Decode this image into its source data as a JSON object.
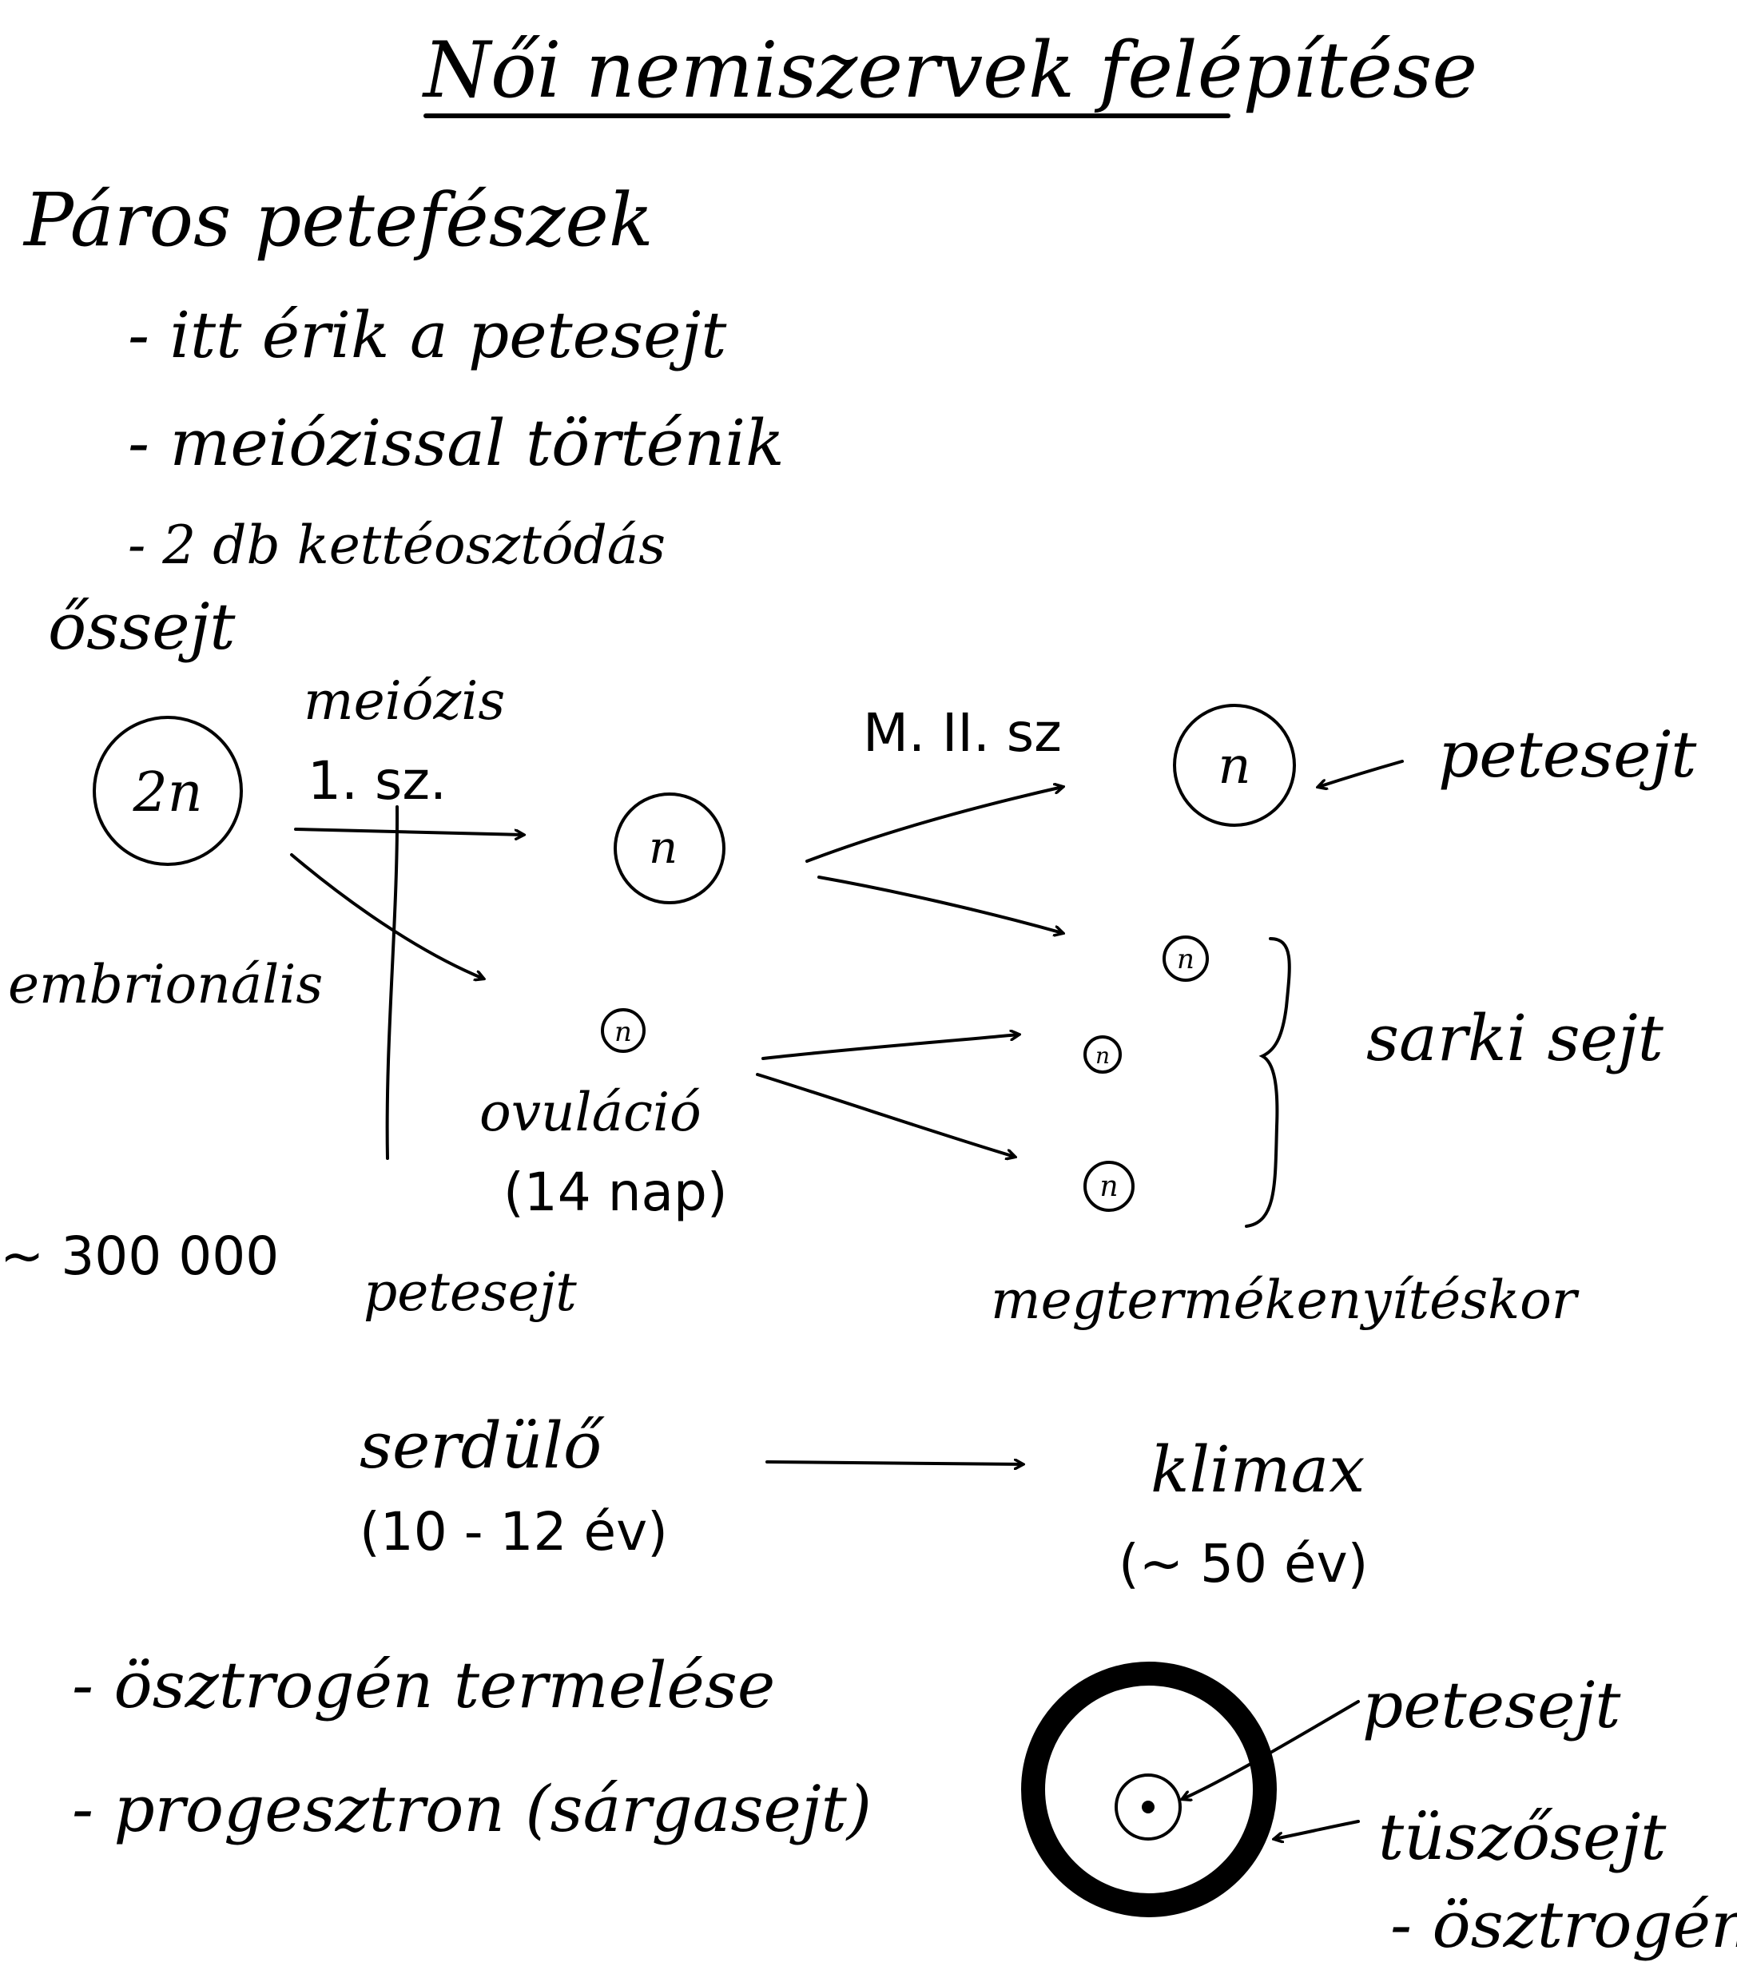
{
  "title": "Női nemiszervek felépítése",
  "section": {
    "heading": "Páros petefészek",
    "bullets": [
      "- itt érik a petesejt",
      "- meiózissal történik",
      "- 2 db kettéosztódás"
    ]
  },
  "diagram": {
    "start_label": "őssejt",
    "start_cell": "2n",
    "meiosis_label": "meiózis",
    "meiosis_sub": "1. sz.",
    "embryonal_label": "embrionális",
    "cell_n": "n",
    "ovulation_label": "ovuláció",
    "ovulation_time": "(14 nap)",
    "m2_label": "M. II. sz",
    "egg_cell_label": "petesejt",
    "polar_body_label": "sarki sejt",
    "fertilization_label": "megtermékenyítéskor",
    "count_label": "~ 300 000",
    "count_unit": "petesejt"
  },
  "timeline": {
    "start_label": "serdülő",
    "start_age": "(10 - 12 év)",
    "end_label": "klimax",
    "end_age": "(~ 50 év)"
  },
  "hormones": [
    "- ösztrogén termelése",
    "- progesztron (sárgasejt)"
  ],
  "follicle": {
    "egg_label": "petesejt",
    "follicle_label": "tüszősejt",
    "follicle_sub": "- ösztrogén"
  }
}
